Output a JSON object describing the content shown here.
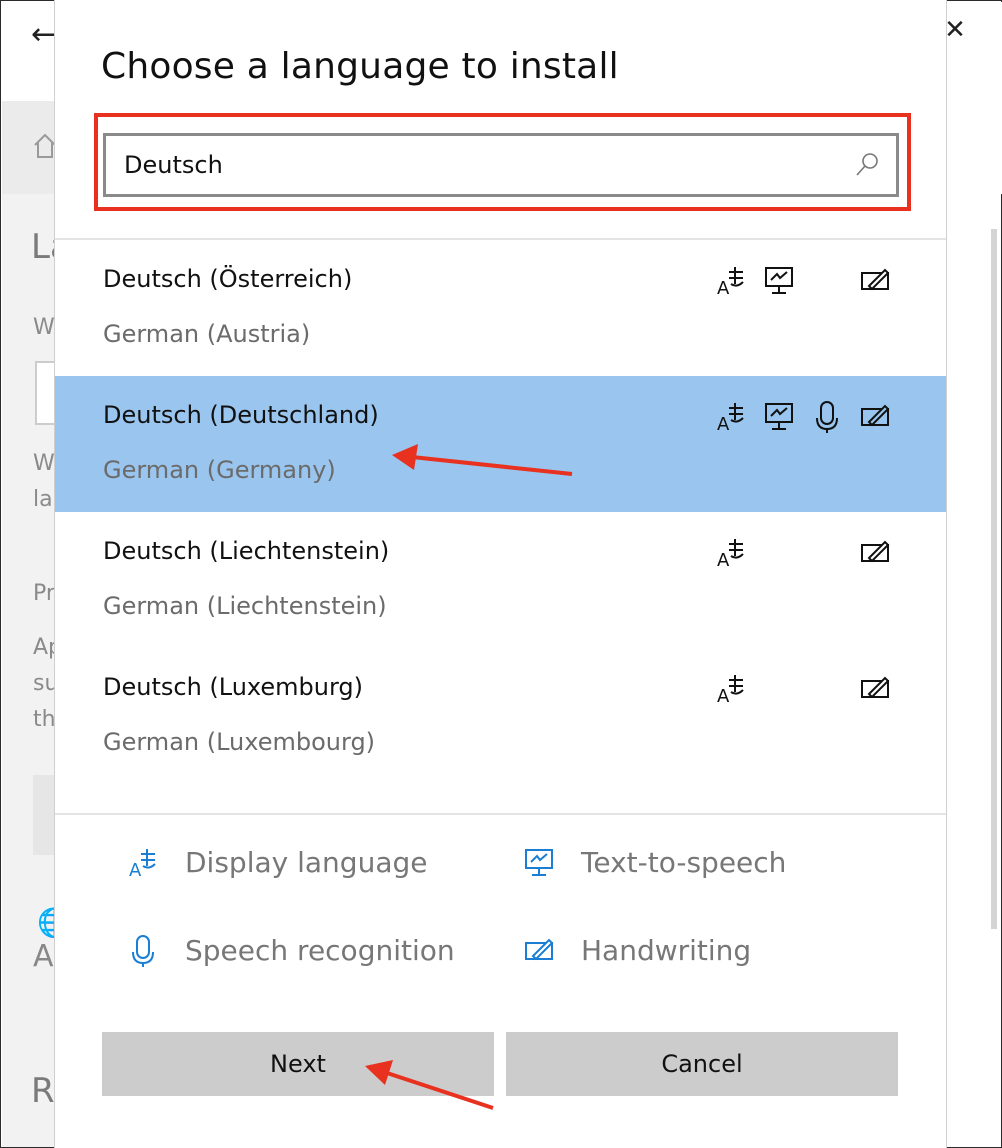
{
  "background_window": {
    "heading_partial": "La",
    "text_partials": [
      "W",
      "W",
      "la",
      "Pr",
      "Ap",
      "su",
      "th",
      "A",
      "R"
    ]
  },
  "dialog": {
    "title": "Choose a language to install",
    "search": {
      "value": "Deutsch",
      "placeholder": ""
    },
    "languages": [
      {
        "name": "Deutsch (Österreich)",
        "english": "German (Austria)",
        "features": [
          "display-language",
          "text-to-speech",
          "handwriting"
        ],
        "selected": false
      },
      {
        "name": "Deutsch (Deutschland)",
        "english": "German (Germany)",
        "features": [
          "display-language",
          "text-to-speech",
          "speech-recognition",
          "handwriting"
        ],
        "selected": true
      },
      {
        "name": "Deutsch (Liechtenstein)",
        "english": "German (Liechtenstein)",
        "features": [
          "display-language",
          "handwriting"
        ],
        "selected": false
      },
      {
        "name": "Deutsch (Luxemburg)",
        "english": "German (Luxembourg)",
        "features": [
          "display-language",
          "handwriting"
        ],
        "selected": false
      }
    ],
    "legend": {
      "display_language": "Display language",
      "text_to_speech": "Text-to-speech",
      "speech_recognition": "Speech recognition",
      "handwriting": "Handwriting"
    },
    "buttons": {
      "next": "Next",
      "cancel": "Cancel"
    }
  },
  "colors": {
    "selected_row": "#99c5ee",
    "highlight_box": "#e8311e",
    "legend_icon": "#1a7fd4",
    "button_bg": "#cccccc"
  }
}
